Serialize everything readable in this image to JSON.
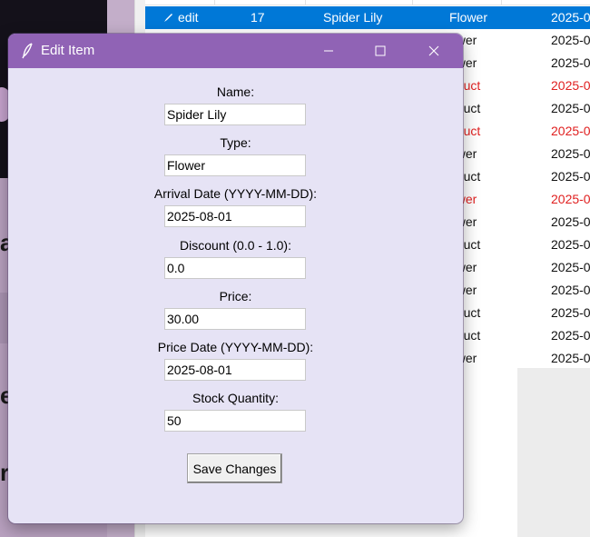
{
  "background": {
    "left_panel_glyphs": [
      "a",
      "e",
      "r"
    ],
    "table_rows": [
      {
        "action": "edit",
        "qty": "17",
        "name": "Spider Lily",
        "type": "Flower",
        "date": "2025-0",
        "selected": true,
        "highlight": false
      },
      {
        "action": "",
        "qty": "",
        "name": "",
        "type": "ower",
        "date": "2025-0",
        "selected": false,
        "highlight": false
      },
      {
        "action": "",
        "qty": "",
        "name": "",
        "type": "ower",
        "date": "2025-0",
        "selected": false,
        "highlight": false
      },
      {
        "action": "",
        "qty": "",
        "name": "",
        "type": "oduct",
        "date": "2025-0",
        "selected": false,
        "highlight": true
      },
      {
        "action": "",
        "qty": "",
        "name": "",
        "type": "oduct",
        "date": "2025-0",
        "selected": false,
        "highlight": false
      },
      {
        "action": "",
        "qty": "",
        "name": "",
        "type": "oduct",
        "date": "2025-0",
        "selected": false,
        "highlight": true
      },
      {
        "action": "",
        "qty": "",
        "name": "",
        "type": "ower",
        "date": "2025-0",
        "selected": false,
        "highlight": false
      },
      {
        "action": "",
        "qty": "",
        "name": "",
        "type": "oduct",
        "date": "2025-0",
        "selected": false,
        "highlight": false
      },
      {
        "action": "",
        "qty": "",
        "name": "",
        "type": "ower",
        "date": "2025-0",
        "selected": false,
        "highlight": true
      },
      {
        "action": "",
        "qty": "",
        "name": "",
        "type": "ower",
        "date": "2025-0",
        "selected": false,
        "highlight": false
      },
      {
        "action": "",
        "qty": "",
        "name": "",
        "type": "oduct",
        "date": "2025-0",
        "selected": false,
        "highlight": false
      },
      {
        "action": "",
        "qty": "",
        "name": "",
        "type": "ower",
        "date": "2025-0",
        "selected": false,
        "highlight": false
      },
      {
        "action": "",
        "qty": "",
        "name": "",
        "type": "ower",
        "date": "2025-0",
        "selected": false,
        "highlight": false
      },
      {
        "action": "",
        "qty": "",
        "name": "",
        "type": "oduct",
        "date": "2025-0",
        "selected": false,
        "highlight": false
      },
      {
        "action": "",
        "qty": "",
        "name": "",
        "type": "oduct",
        "date": "2025-0",
        "selected": false,
        "highlight": false
      },
      {
        "action": "",
        "qty": "",
        "name": "",
        "type": "ower",
        "date": "2025-0",
        "selected": false,
        "highlight": false
      }
    ],
    "colors": {
      "selection": "#0078d7",
      "highlight_text": "#e02020"
    }
  },
  "dialog": {
    "title": "Edit Item",
    "titlebar_color": "#9063b5",
    "body_color": "#e6e3f5",
    "icons": {
      "app": "feather-icon",
      "minimize": "minimize-icon",
      "maximize": "maximize-icon",
      "close": "close-icon"
    },
    "fields": {
      "name": {
        "label": "Name:",
        "value": "Spider Lily"
      },
      "type": {
        "label": "Type:",
        "value": "Flower"
      },
      "arrival_date": {
        "label": "Arrival Date (YYYY-MM-DD):",
        "value": "2025-08-01"
      },
      "discount": {
        "label": "Discount (0.0 - 1.0):",
        "value": "0.0"
      },
      "price": {
        "label": "Price:",
        "value": "30.00"
      },
      "price_date": {
        "label": "Price Date (YYYY-MM-DD):",
        "value": "2025-08-01"
      },
      "stock": {
        "label": "Stock Quantity:",
        "value": "50"
      }
    },
    "save_label": "Save Changes"
  }
}
